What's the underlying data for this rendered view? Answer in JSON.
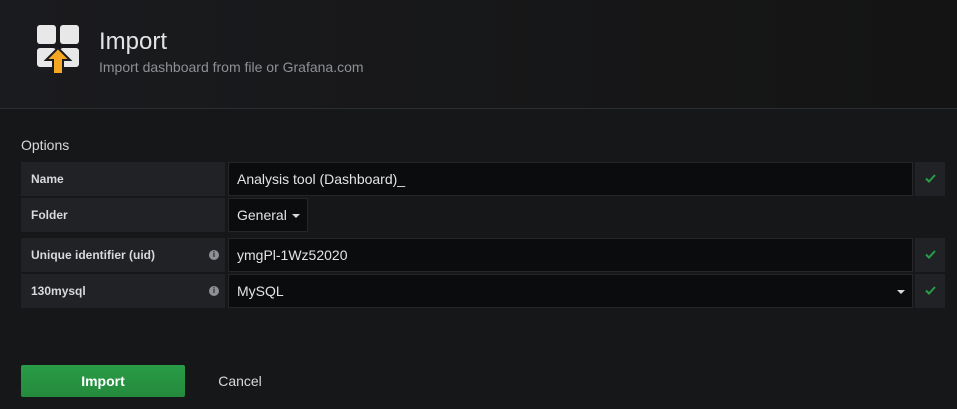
{
  "header": {
    "icon": "dashboard-import-icon",
    "title": "Import",
    "subtitle": "Import dashboard from file or Grafana.com"
  },
  "options": {
    "title": "Options",
    "rows": {
      "name": {
        "label": "Name",
        "value": "Analysis tool (Dashboard)_",
        "valid": true
      },
      "folder": {
        "label": "Folder",
        "value": "General"
      },
      "uid": {
        "label": "Unique identifier (uid)",
        "value": "ymgPl-1Wz52020",
        "valid": true
      },
      "datasource": {
        "label": "130mysql",
        "value": "MySQL",
        "valid": true
      }
    }
  },
  "buttons": {
    "import": "Import",
    "cancel": "Cancel"
  },
  "colors": {
    "valid_check": "#299c46",
    "primary_button": "#299c46",
    "upload_arrow": "#f5a623"
  }
}
